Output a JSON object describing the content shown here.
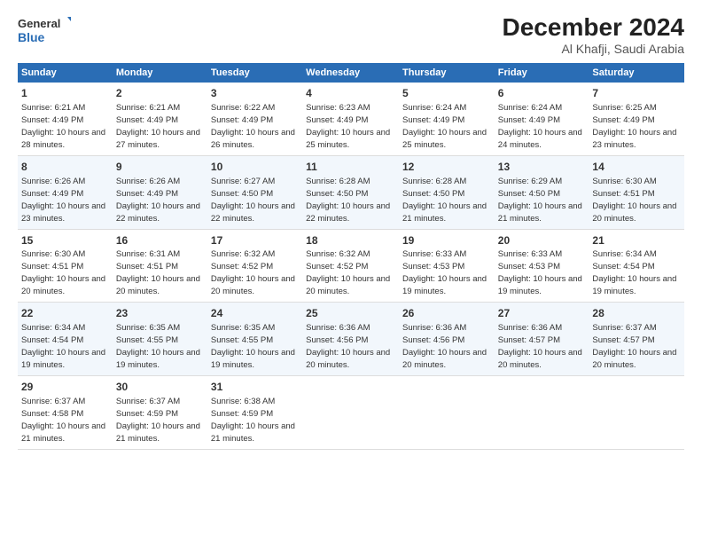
{
  "header": {
    "logo_text_line1": "General",
    "logo_text_line2": "Blue",
    "month_title": "December 2024",
    "location": "Al Khafji, Saudi Arabia"
  },
  "columns": [
    "Sunday",
    "Monday",
    "Tuesday",
    "Wednesday",
    "Thursday",
    "Friday",
    "Saturday"
  ],
  "weeks": [
    [
      {
        "day": "1",
        "sunrise": "6:21 AM",
        "sunset": "4:49 PM",
        "daylight": "10 hours and 28 minutes."
      },
      {
        "day": "2",
        "sunrise": "6:21 AM",
        "sunset": "4:49 PM",
        "daylight": "10 hours and 27 minutes."
      },
      {
        "day": "3",
        "sunrise": "6:22 AM",
        "sunset": "4:49 PM",
        "daylight": "10 hours and 26 minutes."
      },
      {
        "day": "4",
        "sunrise": "6:23 AM",
        "sunset": "4:49 PM",
        "daylight": "10 hours and 25 minutes."
      },
      {
        "day": "5",
        "sunrise": "6:24 AM",
        "sunset": "4:49 PM",
        "daylight": "10 hours and 25 minutes."
      },
      {
        "day": "6",
        "sunrise": "6:24 AM",
        "sunset": "4:49 PM",
        "daylight": "10 hours and 24 minutes."
      },
      {
        "day": "7",
        "sunrise": "6:25 AM",
        "sunset": "4:49 PM",
        "daylight": "10 hours and 23 minutes."
      }
    ],
    [
      {
        "day": "8",
        "sunrise": "6:26 AM",
        "sunset": "4:49 PM",
        "daylight": "10 hours and 23 minutes."
      },
      {
        "day": "9",
        "sunrise": "6:26 AM",
        "sunset": "4:49 PM",
        "daylight": "10 hours and 22 minutes."
      },
      {
        "day": "10",
        "sunrise": "6:27 AM",
        "sunset": "4:50 PM",
        "daylight": "10 hours and 22 minutes."
      },
      {
        "day": "11",
        "sunrise": "6:28 AM",
        "sunset": "4:50 PM",
        "daylight": "10 hours and 22 minutes."
      },
      {
        "day": "12",
        "sunrise": "6:28 AM",
        "sunset": "4:50 PM",
        "daylight": "10 hours and 21 minutes."
      },
      {
        "day": "13",
        "sunrise": "6:29 AM",
        "sunset": "4:50 PM",
        "daylight": "10 hours and 21 minutes."
      },
      {
        "day": "14",
        "sunrise": "6:30 AM",
        "sunset": "4:51 PM",
        "daylight": "10 hours and 20 minutes."
      }
    ],
    [
      {
        "day": "15",
        "sunrise": "6:30 AM",
        "sunset": "4:51 PM",
        "daylight": "10 hours and 20 minutes."
      },
      {
        "day": "16",
        "sunrise": "6:31 AM",
        "sunset": "4:51 PM",
        "daylight": "10 hours and 20 minutes."
      },
      {
        "day": "17",
        "sunrise": "6:32 AM",
        "sunset": "4:52 PM",
        "daylight": "10 hours and 20 minutes."
      },
      {
        "day": "18",
        "sunrise": "6:32 AM",
        "sunset": "4:52 PM",
        "daylight": "10 hours and 20 minutes."
      },
      {
        "day": "19",
        "sunrise": "6:33 AM",
        "sunset": "4:53 PM",
        "daylight": "10 hours and 19 minutes."
      },
      {
        "day": "20",
        "sunrise": "6:33 AM",
        "sunset": "4:53 PM",
        "daylight": "10 hours and 19 minutes."
      },
      {
        "day": "21",
        "sunrise": "6:34 AM",
        "sunset": "4:54 PM",
        "daylight": "10 hours and 19 minutes."
      }
    ],
    [
      {
        "day": "22",
        "sunrise": "6:34 AM",
        "sunset": "4:54 PM",
        "daylight": "10 hours and 19 minutes."
      },
      {
        "day": "23",
        "sunrise": "6:35 AM",
        "sunset": "4:55 PM",
        "daylight": "10 hours and 19 minutes."
      },
      {
        "day": "24",
        "sunrise": "6:35 AM",
        "sunset": "4:55 PM",
        "daylight": "10 hours and 19 minutes."
      },
      {
        "day": "25",
        "sunrise": "6:36 AM",
        "sunset": "4:56 PM",
        "daylight": "10 hours and 20 minutes."
      },
      {
        "day": "26",
        "sunrise": "6:36 AM",
        "sunset": "4:56 PM",
        "daylight": "10 hours and 20 minutes."
      },
      {
        "day": "27",
        "sunrise": "6:36 AM",
        "sunset": "4:57 PM",
        "daylight": "10 hours and 20 minutes."
      },
      {
        "day": "28",
        "sunrise": "6:37 AM",
        "sunset": "4:57 PM",
        "daylight": "10 hours and 20 minutes."
      }
    ],
    [
      {
        "day": "29",
        "sunrise": "6:37 AM",
        "sunset": "4:58 PM",
        "daylight": "10 hours and 21 minutes."
      },
      {
        "day": "30",
        "sunrise": "6:37 AM",
        "sunset": "4:59 PM",
        "daylight": "10 hours and 21 minutes."
      },
      {
        "day": "31",
        "sunrise": "6:38 AM",
        "sunset": "4:59 PM",
        "daylight": "10 hours and 21 minutes."
      },
      null,
      null,
      null,
      null
    ]
  ]
}
